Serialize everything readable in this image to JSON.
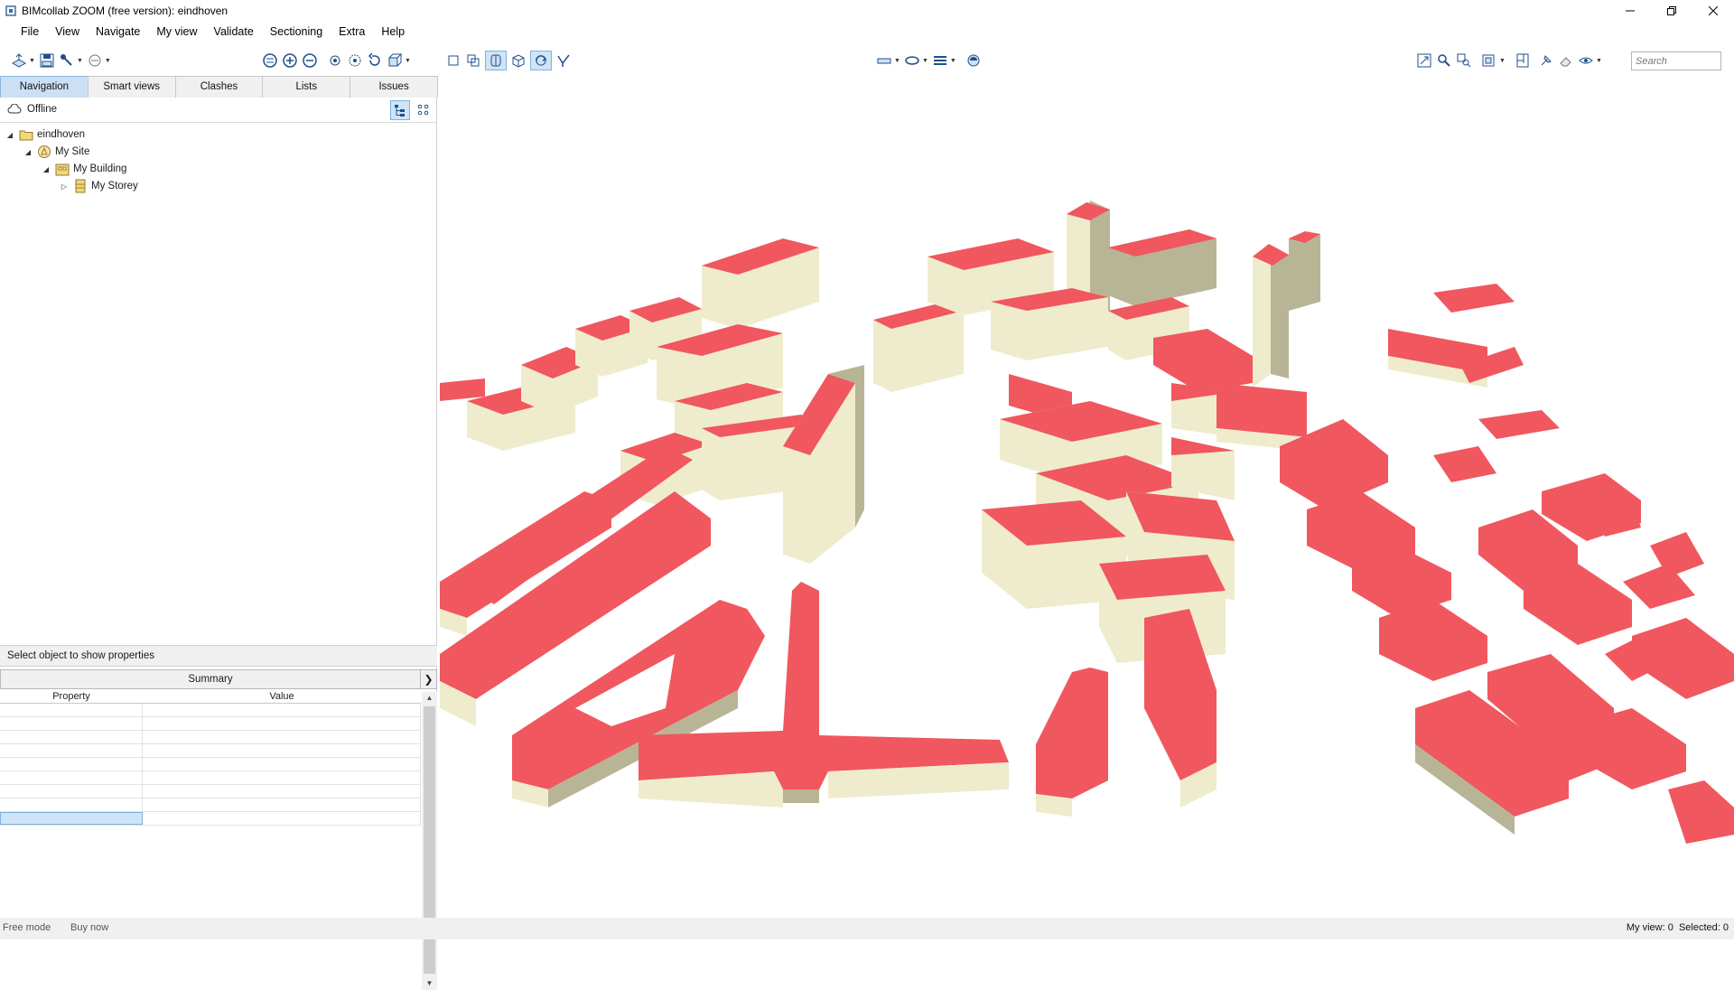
{
  "window": {
    "title": "BIMcollab ZOOM (free version): eindhoven",
    "controls": [
      "minimize",
      "restore",
      "close"
    ]
  },
  "menu": [
    "File",
    "View",
    "Navigate",
    "My view",
    "Validate",
    "Sectioning",
    "Extra",
    "Help"
  ],
  "toolbar": {
    "search_placeholder": "Search"
  },
  "left_panel": {
    "tabs": [
      "Navigation",
      "Smart views",
      "Clashes",
      "Lists",
      "Issues"
    ],
    "active_tab": "Navigation",
    "connection_status": "Offline",
    "tree": [
      {
        "label": "eindhoven",
        "level": 0,
        "expanded": true,
        "icon": "folder-icon"
      },
      {
        "label": "My Site",
        "level": 1,
        "expanded": true,
        "icon": "site-icon"
      },
      {
        "label": "My Building",
        "level": 2,
        "expanded": true,
        "icon": "building-icon"
      },
      {
        "label": "My Storey",
        "level": 3,
        "expanded": false,
        "icon": "storey-icon"
      }
    ]
  },
  "properties": {
    "header": "Select object to show properties",
    "summary_label": "Summary",
    "columns": [
      "Property",
      "Value"
    ],
    "row_count": 9
  },
  "statusbar": {
    "mode": "Free mode",
    "buy": "Buy now",
    "my_view": "My view: 0",
    "selected": "Selected: 0"
  },
  "colors": {
    "roof": "#f0575e",
    "wall": "#efeccd",
    "wall_shade": "#b8b597",
    "active_tab": "#cce0f5"
  }
}
